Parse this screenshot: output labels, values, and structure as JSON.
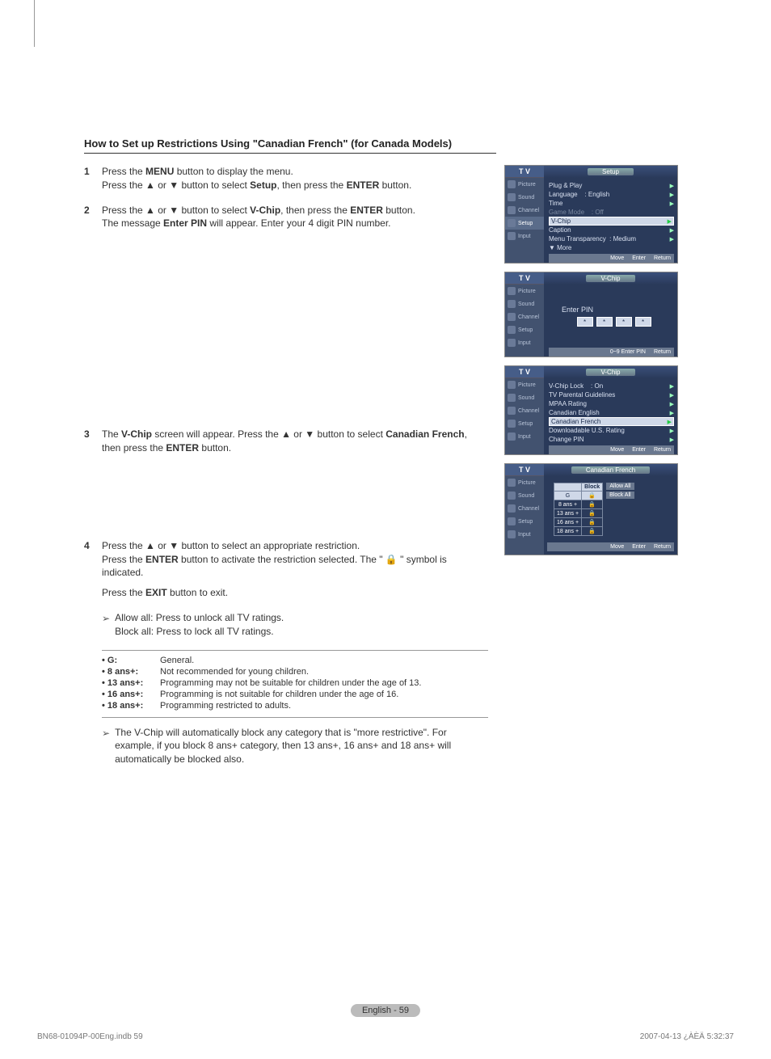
{
  "title": "How to Set up Restrictions Using \"Canadian French\" (for Canada Models)",
  "steps": {
    "s1": {
      "num": "1",
      "line1_a": "Press the ",
      "line1_b": "MENU",
      "line1_c": " button to display the menu.",
      "line2_a": "Press the ▲ or ▼ button to select ",
      "line2_b": "Setup",
      "line2_c": ", then press the ",
      "line2_d": "ENTER",
      "line2_e": " button."
    },
    "s2": {
      "num": "2",
      "line1_a": "Press the ▲ or ▼ button to select ",
      "line1_b": "V-Chip",
      "line1_c": ", then press the ",
      "line1_d": "ENTER",
      "line1_e": " button.",
      "line2_a": "The message ",
      "line2_b": "Enter PIN",
      "line2_c": " will appear. Enter your 4 digit PIN number."
    },
    "s3": {
      "num": "3",
      "line1_a": "The ",
      "line1_b": "V-Chip",
      "line1_c": " screen will appear. Press the ▲ or ▼ button to select ",
      "line1_d": "Canadian French",
      "line1_e": ", then press the ",
      "line1_f": "ENTER",
      "line1_g": " button."
    },
    "s4": {
      "num": "4",
      "line1": "Press the ▲ or ▼ button to select an appropriate restriction.",
      "line2_a": "Press the ",
      "line2_b": "ENTER",
      "line2_c": " button to activate the restriction selected. The \" 🔒 \" symbol is indicated.",
      "exit_a": "Press the ",
      "exit_b": "EXIT",
      "exit_c": " button to exit.",
      "allow_label": "Allow all:",
      "allow_desc": " Press to unlock all TV ratings.",
      "block_label": "Block all:",
      "block_desc": " Press to lock all TV ratings."
    }
  },
  "ratings": [
    {
      "lbl": "• G:",
      "desc": "General."
    },
    {
      "lbl": "• 8 ans+:",
      "desc": "Not recommended for young children."
    },
    {
      "lbl": "• 13 ans+:",
      "desc": "Programming may not be suitable for children under the age of 13."
    },
    {
      "lbl": "• 16 ans+:",
      "desc": "Programming is not suitable for children under the age of 16."
    },
    {
      "lbl": "• 18 ans+:",
      "desc": "Programming restricted to adults."
    }
  ],
  "auto_block_note": "The V-Chip will automatically block any category that is \"more restrictive\". For example, if you block 8 ans+ category, then 13 ans+, 16 ans+ and 18 ans+ will automatically be blocked also.",
  "osd": {
    "tv_label": "T V",
    "side_items": [
      "Picture",
      "Sound",
      "Channel",
      "Setup",
      "Input"
    ],
    "setup": {
      "title": "Setup",
      "rows": [
        {
          "l": "Plug & Play",
          "r": "",
          "tri": true
        },
        {
          "l": "Language",
          "r": ": English",
          "tri": true
        },
        {
          "l": "Time",
          "r": "",
          "tri": true
        },
        {
          "l": "Game Mode",
          "r": ": Off",
          "tri": false,
          "dim": true
        },
        {
          "l": "V-Chip",
          "r": "",
          "tri": true,
          "hl": true
        },
        {
          "l": "Caption",
          "r": "",
          "tri": true
        },
        {
          "l": "Menu Transparency",
          "r": ": Medium",
          "tri": true
        },
        {
          "l": "▼ More",
          "r": "",
          "tri": false
        }
      ],
      "footer": [
        "Move",
        "Enter",
        "Return"
      ]
    },
    "pin": {
      "title": "V-Chip",
      "label": "Enter PIN",
      "box": "*",
      "footer": [
        "0~9 Enter PIN",
        "Return"
      ]
    },
    "vchip": {
      "title": "V-Chip",
      "rows": [
        {
          "l": "V-Chip Lock",
          "r": ": On",
          "tri": true
        },
        {
          "l": "TV Parental Guidelines",
          "r": "",
          "tri": true
        },
        {
          "l": "MPAA Rating",
          "r": "",
          "tri": true
        },
        {
          "l": "Canadian English",
          "r": "",
          "tri": true
        },
        {
          "l": "Canadian French",
          "r": "",
          "tri": true,
          "hl": true
        },
        {
          "l": "Downloadable U.S. Rating",
          "r": "",
          "tri": true
        },
        {
          "l": "Change PIN",
          "r": "",
          "tri": true
        }
      ],
      "footer": [
        "Move",
        "Enter",
        "Return"
      ]
    },
    "cf": {
      "title": "Canadian French",
      "header": "Block",
      "categories": [
        "G",
        "8 ans +",
        "13 ans +",
        "16 ans +",
        "18 ans +"
      ],
      "lock": "🔒",
      "allow": "Allow All",
      "block": "Block All",
      "footer": [
        "Move",
        "Enter",
        "Return"
      ]
    }
  },
  "page_footer": "English - 59",
  "doc_footer": {
    "left": "BN68-01094P-00Eng.indb   59",
    "right": "2007-04-13   ¿ÀÈÄ 5:32:37"
  }
}
